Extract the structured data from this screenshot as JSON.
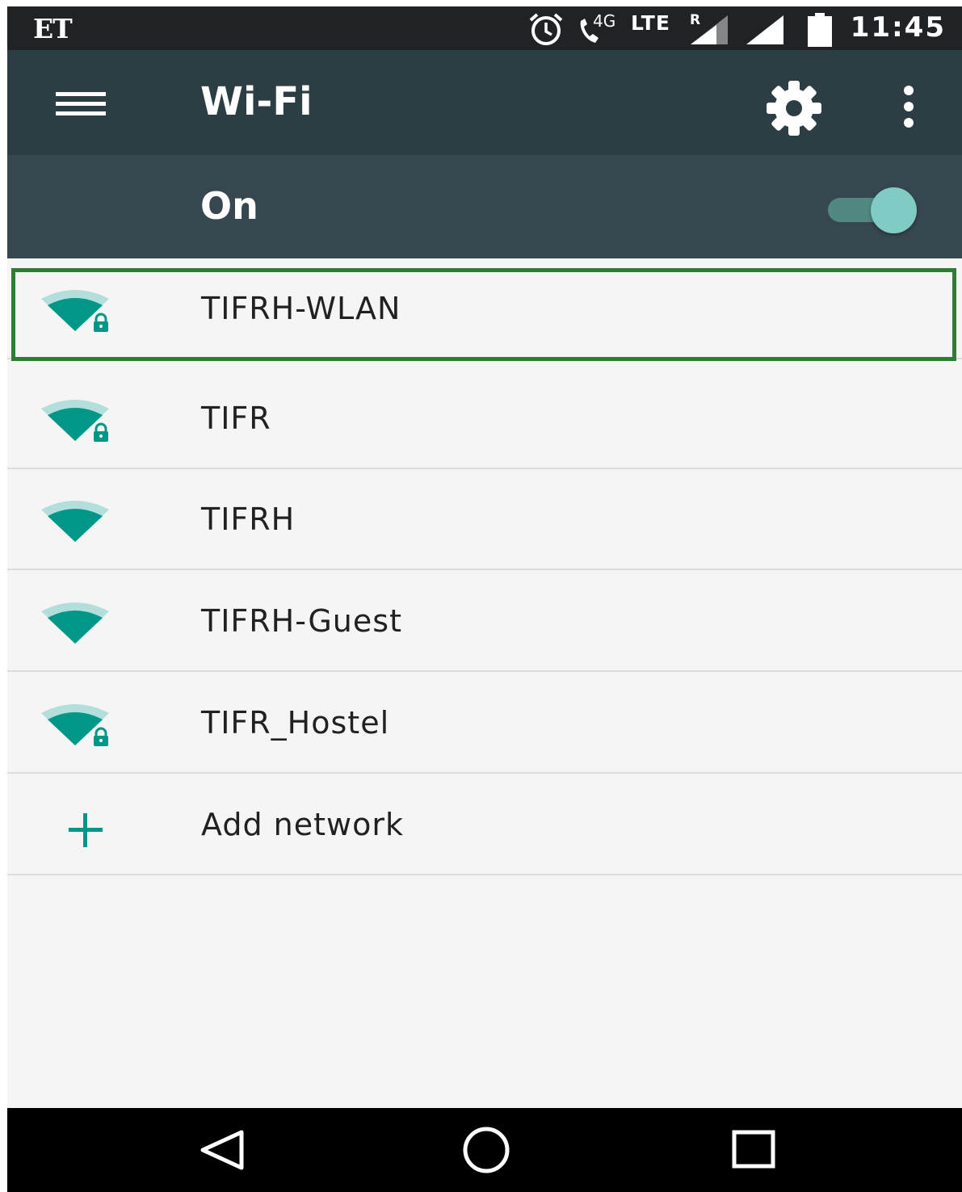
{
  "status_bar": {
    "left_label": "ET",
    "network_4g": "4G",
    "lte": "LTE",
    "roaming": "R",
    "time": "11:45",
    "icons": [
      "alarm-icon",
      "call-icon",
      "signal-icon",
      "signal-icon",
      "battery-icon"
    ]
  },
  "app_bar": {
    "title": "Wi-Fi",
    "icons": [
      "menu-icon",
      "settings-gear-icon",
      "more-vert-icon"
    ]
  },
  "wifi_switch": {
    "label": "On",
    "state": "on"
  },
  "networks": [
    {
      "ssid": "TIFRH-WLAN",
      "secured": true,
      "selected": true
    },
    {
      "ssid": "TIFR",
      "secured": true,
      "selected": false
    },
    {
      "ssid": "TIFRH",
      "secured": false,
      "selected": false
    },
    {
      "ssid": "TIFRH-Guest",
      "secured": false,
      "selected": false
    },
    {
      "ssid": "TIFR_Hostel",
      "secured": true,
      "selected": false
    }
  ],
  "add_network": {
    "label": "Add network",
    "icon": "plus-icon"
  },
  "nav_bar": {
    "icons": [
      "back-icon",
      "home-icon",
      "recents-icon"
    ]
  },
  "colors": {
    "status_bar": "#1f2326",
    "app_bar": "#2c3d44",
    "switch_bar": "#37474f",
    "accent": "#009688",
    "highlight": "#2e7d32"
  }
}
